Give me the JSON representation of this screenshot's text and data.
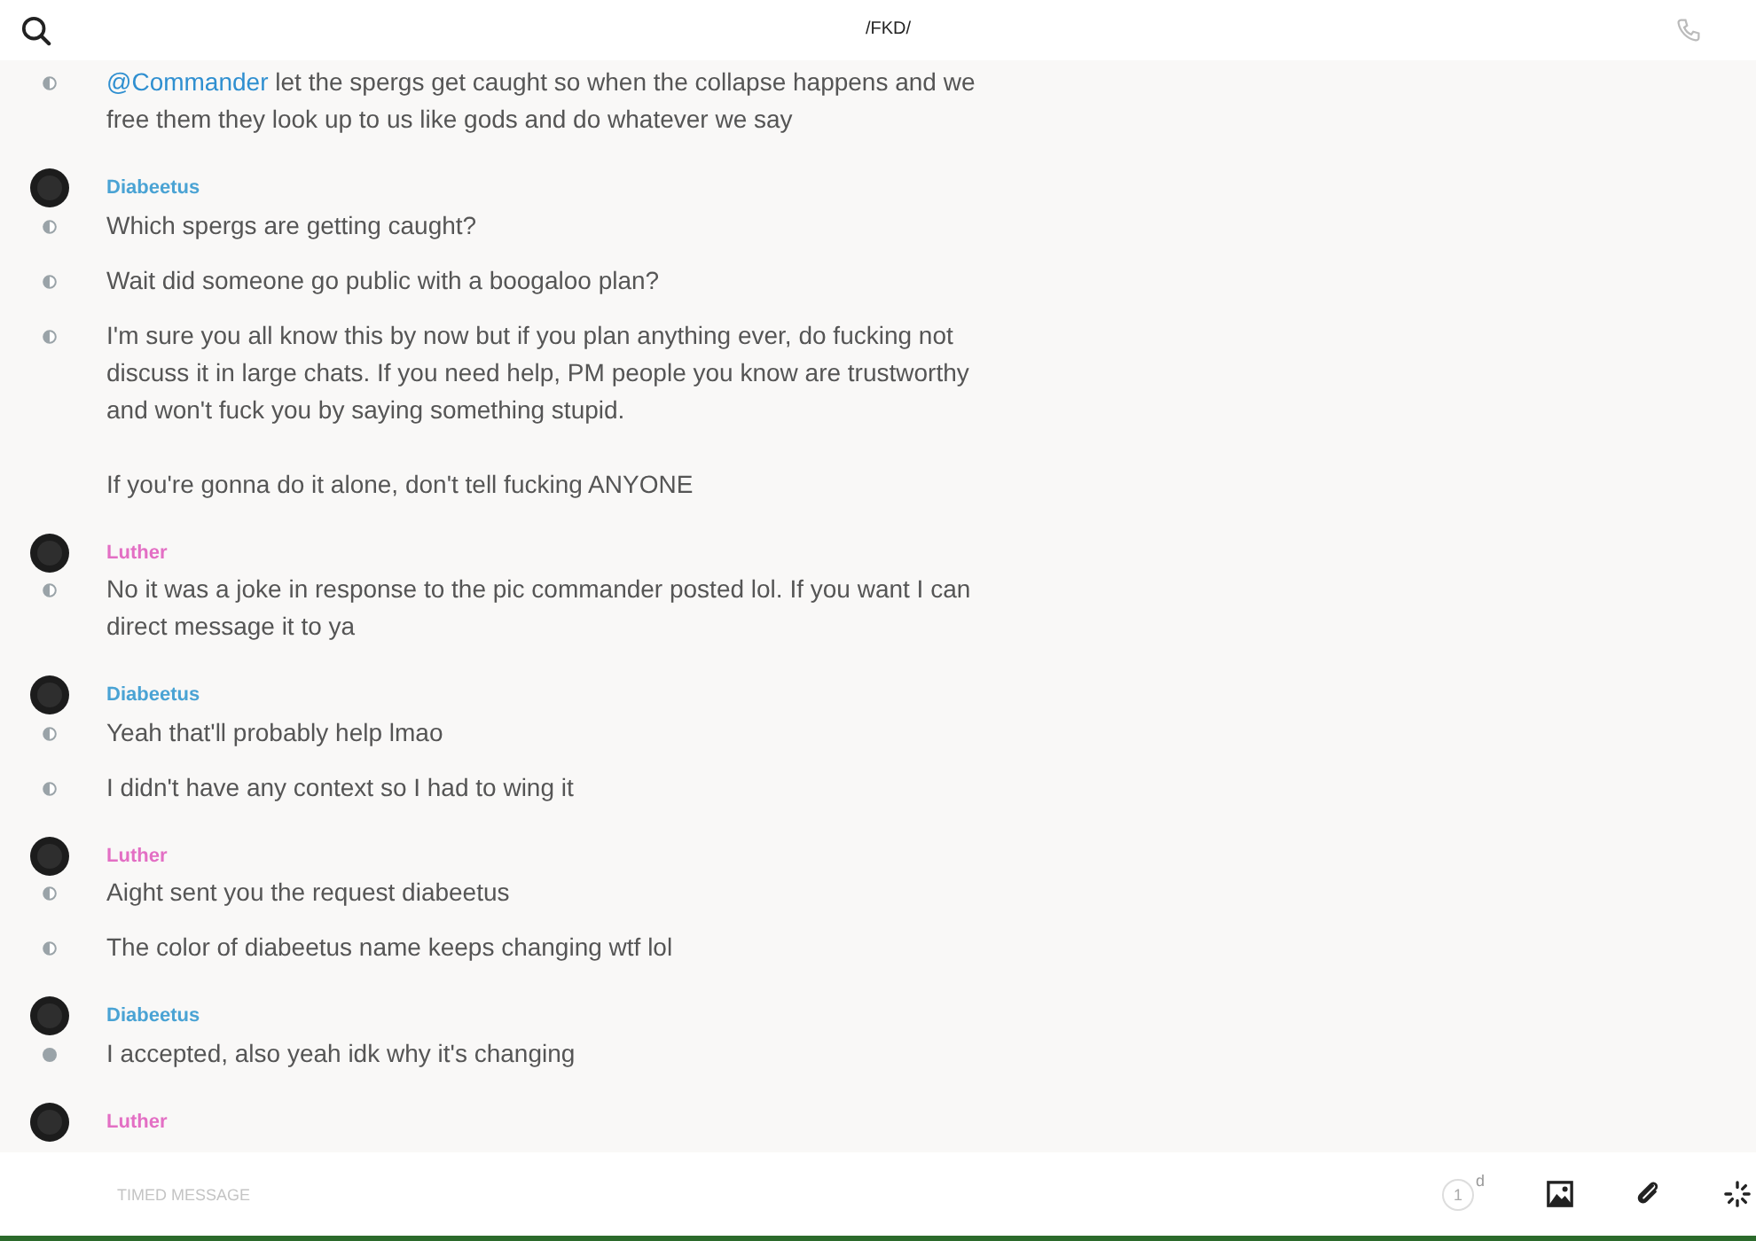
{
  "header": {
    "title": "/FKD/"
  },
  "groups": [
    {
      "messages": [
        {
          "mention": "@Commander",
          "text": " let the spergs get caught so when the collapse happens and we free them they look up to us like gods and do whatever we say",
          "read": true
        }
      ]
    },
    {
      "author": "Diabeetus",
      "color": "#4aa3d4",
      "messages": [
        {
          "text": "Which spergs are getting caught?",
          "read": true
        },
        {
          "text": "Wait did someone go public with a boogaloo plan?",
          "read": true
        },
        {
          "text": "I'm sure you all know this by now but if you plan anything ever, do fucking not discuss it in large chats. If you need help, PM people you know are trustworthy and won't fuck you by saying something stupid.\n\nIf you're gonna do it alone, don't tell fucking ANYONE",
          "read": true
        }
      ]
    },
    {
      "author": "Luther",
      "color": "#e36fc4",
      "messages": [
        {
          "text": "No it was a joke in response to the pic commander posted lol. If you want I can direct message it to ya",
          "read": true
        }
      ]
    },
    {
      "author": "Diabeetus",
      "color": "#4aa3d4",
      "messages": [
        {
          "text": "Yeah that'll probably help lmao",
          "read": true
        },
        {
          "text": "I didn't have any context so I had to wing it",
          "read": true
        }
      ]
    },
    {
      "author": "Luther",
      "color": "#e36fc4",
      "messages": [
        {
          "text": "Aight sent you the request diabeetus",
          "read": true
        },
        {
          "text": "The color of diabeetus name keeps changing wtf lol",
          "read": true
        }
      ]
    },
    {
      "author": "Diabeetus",
      "color": "#4aa3d4",
      "messages": [
        {
          "text": "I accepted, also yeah idk why it's changing",
          "read": false
        }
      ]
    },
    {
      "author": "Luther",
      "color": "#e36fc4"
    }
  ],
  "composer": {
    "placeholder": "TIMED MESSAGE",
    "timer": "1",
    "timer_unit": "d"
  }
}
